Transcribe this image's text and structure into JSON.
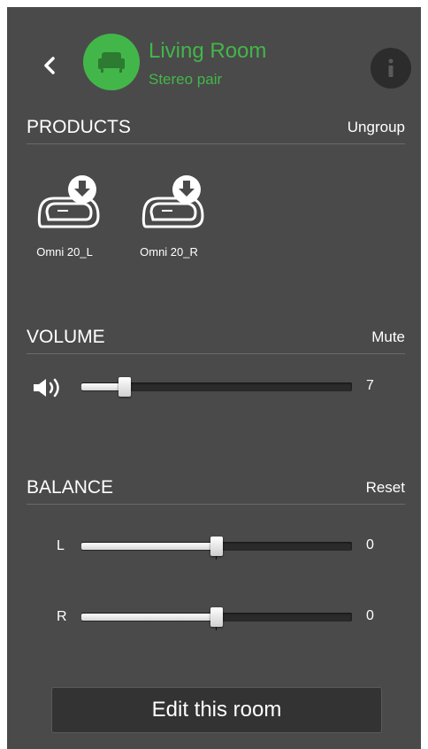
{
  "header": {
    "room_name": "Living Room",
    "room_subtitle": "Stereo pair",
    "back_icon": "chevron-left-icon",
    "room_icon": "sofa-icon",
    "info_icon": "info-icon",
    "accent_color": "#43b649"
  },
  "products": {
    "title": "PRODUCTS",
    "action": "Ungroup",
    "items": [
      {
        "name": "Omni 20_L",
        "icon": "speaker-download-icon"
      },
      {
        "name": "Omni 20_R",
        "icon": "speaker-download-icon"
      }
    ]
  },
  "volume": {
    "title": "VOLUME",
    "action": "Mute",
    "icon": "speaker-volume-icon",
    "value": "7",
    "level_fraction": 0.16
  },
  "balance": {
    "title": "BALANCE",
    "action": "Reset",
    "left": {
      "label": "L",
      "value": "0",
      "level_fraction": 0.5
    },
    "right": {
      "label": "R",
      "value": "0",
      "level_fraction": 0.5
    }
  },
  "footer": {
    "edit_label": "Edit this room"
  }
}
